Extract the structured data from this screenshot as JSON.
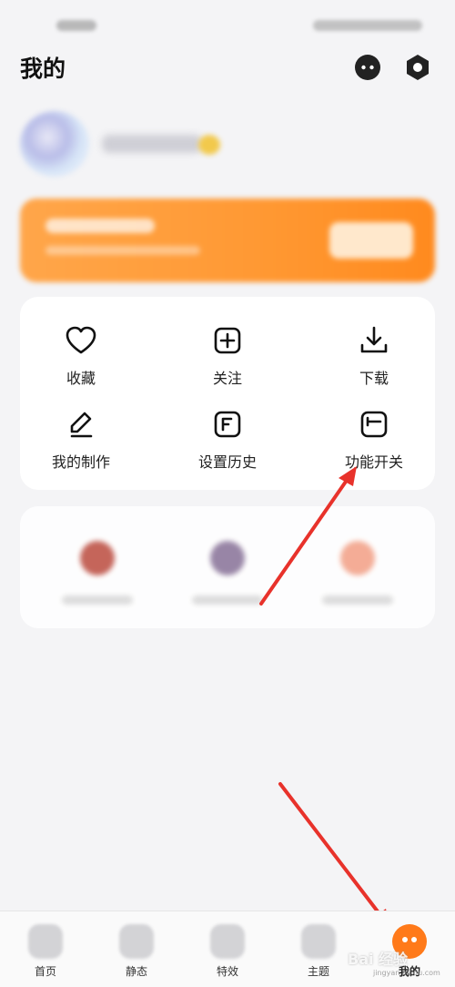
{
  "header": {
    "title": "我的"
  },
  "function_grid": [
    {
      "label": "收藏",
      "icon": "heart-icon"
    },
    {
      "label": "关注",
      "icon": "add-square-icon"
    },
    {
      "label": "下载",
      "icon": "download-icon"
    },
    {
      "label": "我的制作",
      "icon": "pen-icon"
    },
    {
      "label": "设置历史",
      "icon": "history-icon"
    },
    {
      "label": "功能开关",
      "icon": "switch-icon"
    }
  ],
  "tab_bar": [
    {
      "label": "首页",
      "icon": "home-icon"
    },
    {
      "label": "静态",
      "icon": "wallpaper-icon"
    },
    {
      "label": "特效",
      "icon": "star-icon"
    },
    {
      "label": "主题",
      "icon": "palette-icon"
    },
    {
      "label": "我的",
      "icon": "mascot-icon",
      "active": true
    }
  ],
  "watermark": {
    "brand": "Bai 经验",
    "url": "jingyan.baidu.com"
  },
  "colors": {
    "accent": "#ff7a1a",
    "vip_banner": "#ff9832",
    "annotation_arrow": "#e8322b"
  }
}
